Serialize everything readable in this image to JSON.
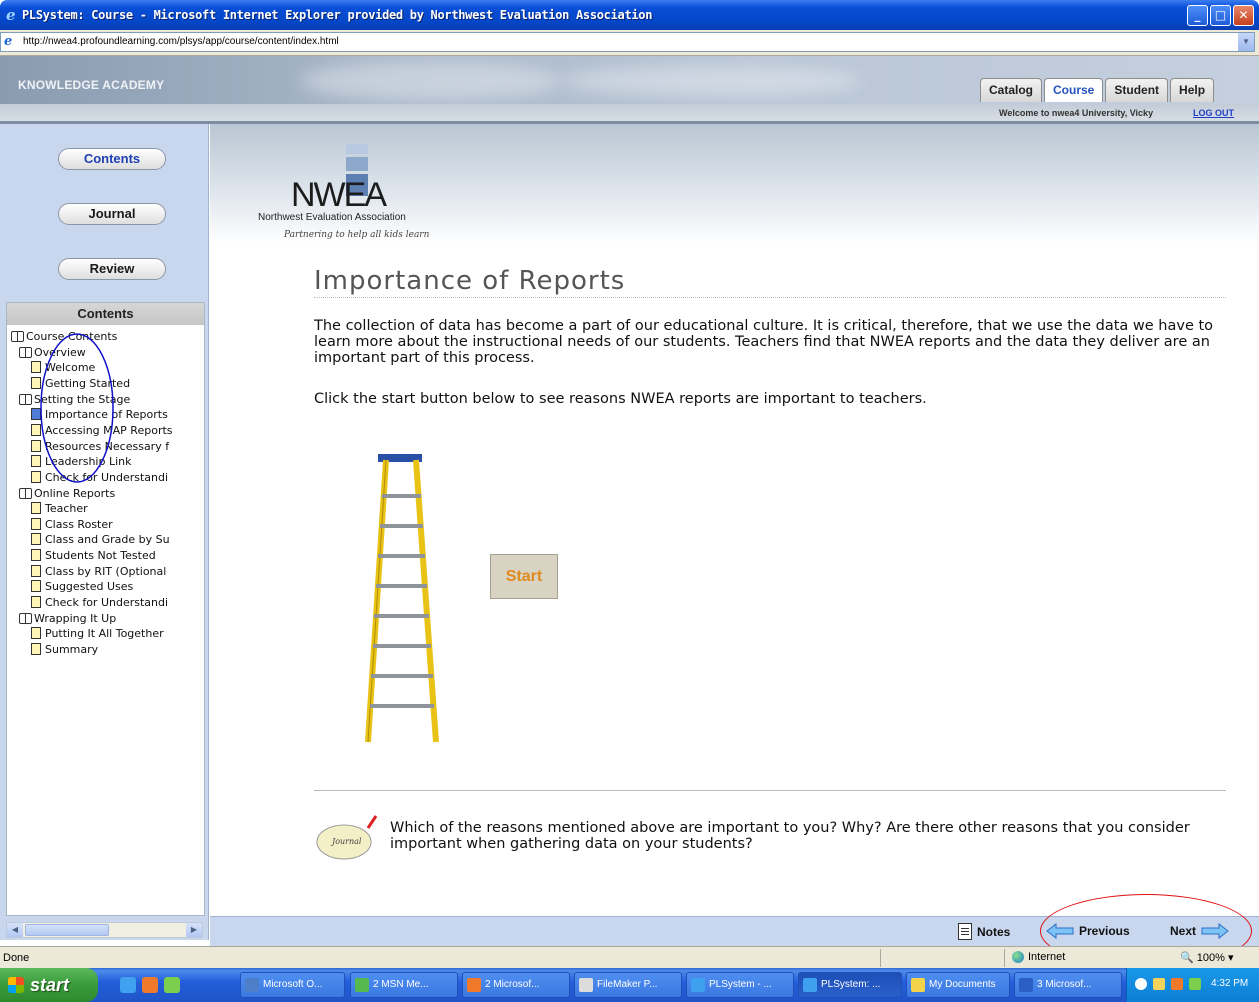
{
  "window": {
    "title": "PLSystem: Course - Microsoft Internet Explorer provided by Northwest Evaluation Association",
    "min_label": "_",
    "max_label": "□",
    "close_label": "✕"
  },
  "address_bar": {
    "url": "http://nwea4.profoundlearning.com/plsys/app/course/content/index.html",
    "icon": "ie-page-icon"
  },
  "header": {
    "brand": "KNOWLEDGE ACADEMY",
    "tabs": [
      {
        "label": "Catalog",
        "active": false
      },
      {
        "label": "Course",
        "active": true
      },
      {
        "label": "Student",
        "active": false
      },
      {
        "label": "Help",
        "active": false
      }
    ],
    "welcome": "Welcome to nwea4 University, Vicky",
    "logout": "LOG OUT"
  },
  "sidebar": {
    "buttons": {
      "contents": "Contents",
      "journal": "Journal",
      "review": "Review"
    },
    "toc_title": "Contents",
    "toc": [
      {
        "label": "Course Contents",
        "type": "book",
        "level": 0
      },
      {
        "label": "Overview",
        "type": "book",
        "level": 1
      },
      {
        "label": "Welcome",
        "type": "page",
        "level": 2
      },
      {
        "label": "Getting Started",
        "type": "page",
        "level": 2
      },
      {
        "label": "Setting the Stage",
        "type": "book",
        "level": 1
      },
      {
        "label": "Importance of Reports",
        "type": "page",
        "level": 2,
        "current": true
      },
      {
        "label": "Accessing MAP Reports",
        "type": "page",
        "level": 2
      },
      {
        "label": "Resources Necessary f",
        "type": "page",
        "level": 2
      },
      {
        "label": "Leadership Link",
        "type": "page",
        "level": 2
      },
      {
        "label": "Check for Understandi",
        "type": "page",
        "level": 2
      },
      {
        "label": "Online Reports",
        "type": "book",
        "level": 1
      },
      {
        "label": "Teacher",
        "type": "page",
        "level": 2
      },
      {
        "label": "Class Roster",
        "type": "page",
        "level": 2
      },
      {
        "label": "Class and Grade by Su",
        "type": "page",
        "level": 2
      },
      {
        "label": "Students Not Tested",
        "type": "page",
        "level": 2
      },
      {
        "label": "Class by RIT (Optional",
        "type": "page",
        "level": 2
      },
      {
        "label": "Suggested Uses",
        "type": "page",
        "level": 2
      },
      {
        "label": "Check for Understandi",
        "type": "page",
        "level": 2
      },
      {
        "label": "Wrapping It Up",
        "type": "book",
        "level": 1
      },
      {
        "label": "Putting It All Together",
        "type": "page",
        "level": 2
      },
      {
        "label": "Summary",
        "type": "page",
        "level": 2
      }
    ]
  },
  "content": {
    "logo": {
      "name": "NWEA",
      "subtitle": "Northwest Evaluation Association",
      "tagline": "Partnering to help all kids learn"
    },
    "title": "Importance of Reports",
    "paragraph1": "The collection of data has become a part of our educational culture. It is critical, therefore, that we use the data we have to learn more about the instructional needs of our students. Teachers find that NWEA reports and the data they deliver are an important part of this process.",
    "paragraph2": "Click the start button below to see reasons NWEA reports are important to teachers.",
    "start_button": "Start",
    "journal_icon_label": "Journal",
    "journal_prompt": "Which of the reasons mentioned above are important to you? Why? Are there other reasons that you consider important when gathering data on your students?"
  },
  "course_toolbar": {
    "notes": "Notes",
    "previous": "Previous",
    "next": "Next"
  },
  "statusbar": {
    "status": "Done",
    "zone": "Internet",
    "zoom": "100%"
  },
  "taskbar": {
    "start": "start",
    "tasks": [
      {
        "label": "Microsoft O..."
      },
      {
        "label": "2 MSN Me..."
      },
      {
        "label": "2 Microsof..."
      },
      {
        "label": "FileMaker P..."
      },
      {
        "label": "PLSystem - ..."
      },
      {
        "label": "PLSystem: ..."
      },
      {
        "label": "My Documents"
      },
      {
        "label": "3 Microsof..."
      }
    ],
    "clock": "4:32 PM"
  },
  "colors": {
    "accent": "#2453c0",
    "sidebar": "#c8d7ee",
    "annotation": "#e01010",
    "start_text": "#e08a1e"
  }
}
